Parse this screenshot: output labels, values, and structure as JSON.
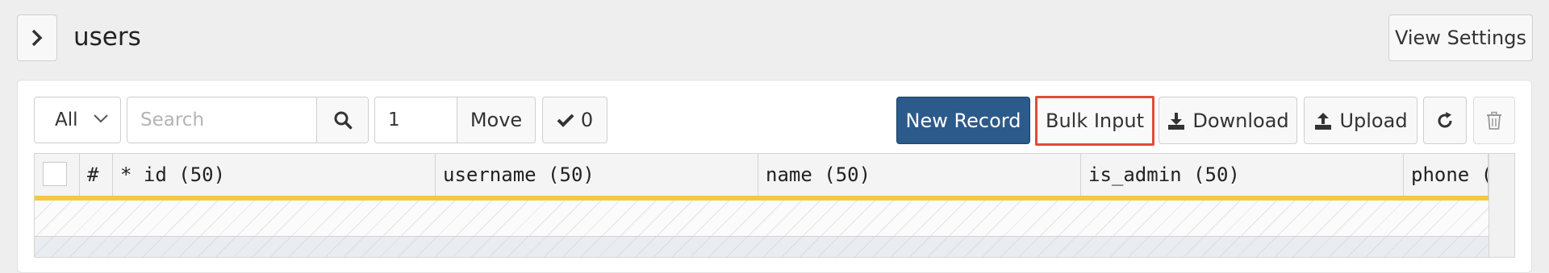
{
  "header": {
    "title": "users",
    "view_settings_label": "View Settings"
  },
  "toolbar": {
    "filter_value": "All",
    "search_placeholder": "Search",
    "page_value": "1",
    "move_label": "Move",
    "checked_count": "0",
    "new_record_label": "New Record",
    "bulk_input_label": "Bulk Input",
    "download_label": "Download",
    "upload_label": "Upload"
  },
  "grid": {
    "columns": [
      {
        "label": "#"
      },
      {
        "label": "* id (50)"
      },
      {
        "label": "username (50)"
      },
      {
        "label": "name (50)"
      },
      {
        "label": "is_admin (50)"
      },
      {
        "label": "phone ("
      }
    ]
  },
  "colors": {
    "primary": "#2c5a8a",
    "highlight_border": "#e44a36",
    "new_row_accent": "#f7c548"
  }
}
